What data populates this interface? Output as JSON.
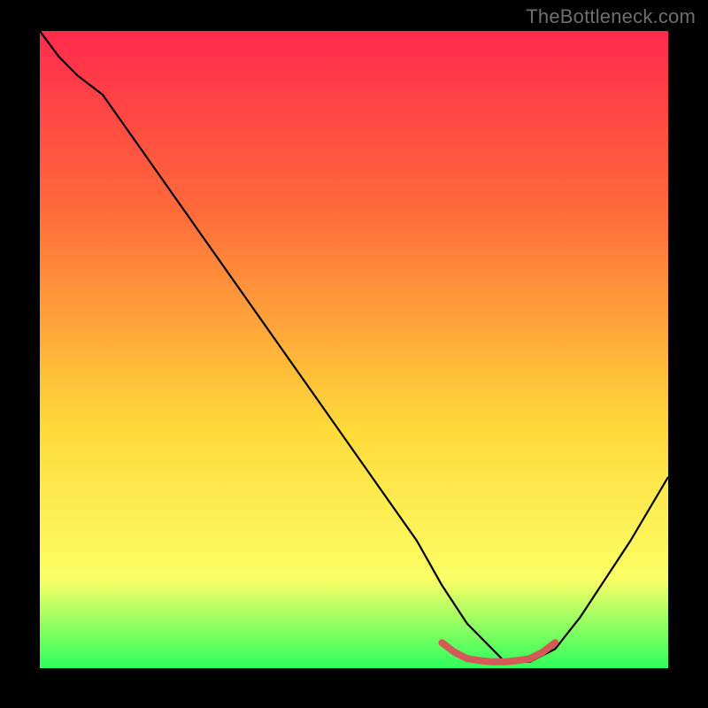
{
  "watermark": "TheBottleneck.com",
  "chart_data": {
    "type": "line",
    "title": "",
    "xlabel": "",
    "ylabel": "",
    "xlim": [
      0,
      100
    ],
    "ylim": [
      0,
      100
    ],
    "grid": false,
    "legend": false,
    "series": [
      {
        "name": "bottleneck-curve",
        "x": [
          0,
          3,
          6,
          10,
          15,
          20,
          25,
          30,
          35,
          40,
          45,
          50,
          55,
          60,
          64,
          68,
          72,
          74,
          78,
          82,
          86,
          90,
          94,
          100
        ],
        "y": [
          100,
          96,
          93,
          90,
          83,
          76,
          69,
          62,
          55,
          48,
          41,
          34,
          27,
          20,
          13,
          7,
          3,
          1,
          1,
          3,
          8,
          14,
          20,
          30
        ]
      },
      {
        "name": "optimum-marker",
        "x": [
          64,
          66,
          68,
          70,
          72,
          74,
          76,
          78,
          80,
          82
        ],
        "y": [
          4,
          2.5,
          1.5,
          1.2,
          1,
          1,
          1.2,
          1.5,
          2.5,
          4
        ]
      }
    ],
    "colors": {
      "gradient_top": "#ff2a4d",
      "gradient_mid1": "#ff6a3a",
      "gradient_mid2": "#ffd93a",
      "gradient_low": "#fbff66",
      "gradient_bottom": "#2dff5e",
      "curve": "#000000",
      "marker": "#d45a57"
    }
  }
}
